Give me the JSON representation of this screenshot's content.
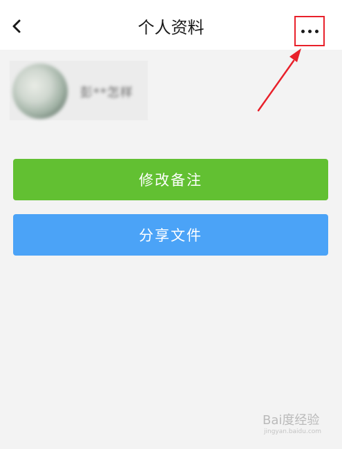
{
  "header": {
    "title": "个人资料",
    "back_icon": "chevron-left-icon",
    "more_icon": "more-horizontal-icon"
  },
  "profile": {
    "name": "彭**怎样"
  },
  "actions": {
    "edit_note_label": "修改备注",
    "share_file_label": "分享文件"
  },
  "colors": {
    "green_button": "#62c032",
    "blue_button": "#4ba3f7",
    "annotation_red": "#e8202a",
    "background": "#f3f3f3",
    "header_bg": "#ffffff"
  },
  "watermark": {
    "main": "Bai度经验",
    "sub": "jingyan.baidu.com"
  }
}
